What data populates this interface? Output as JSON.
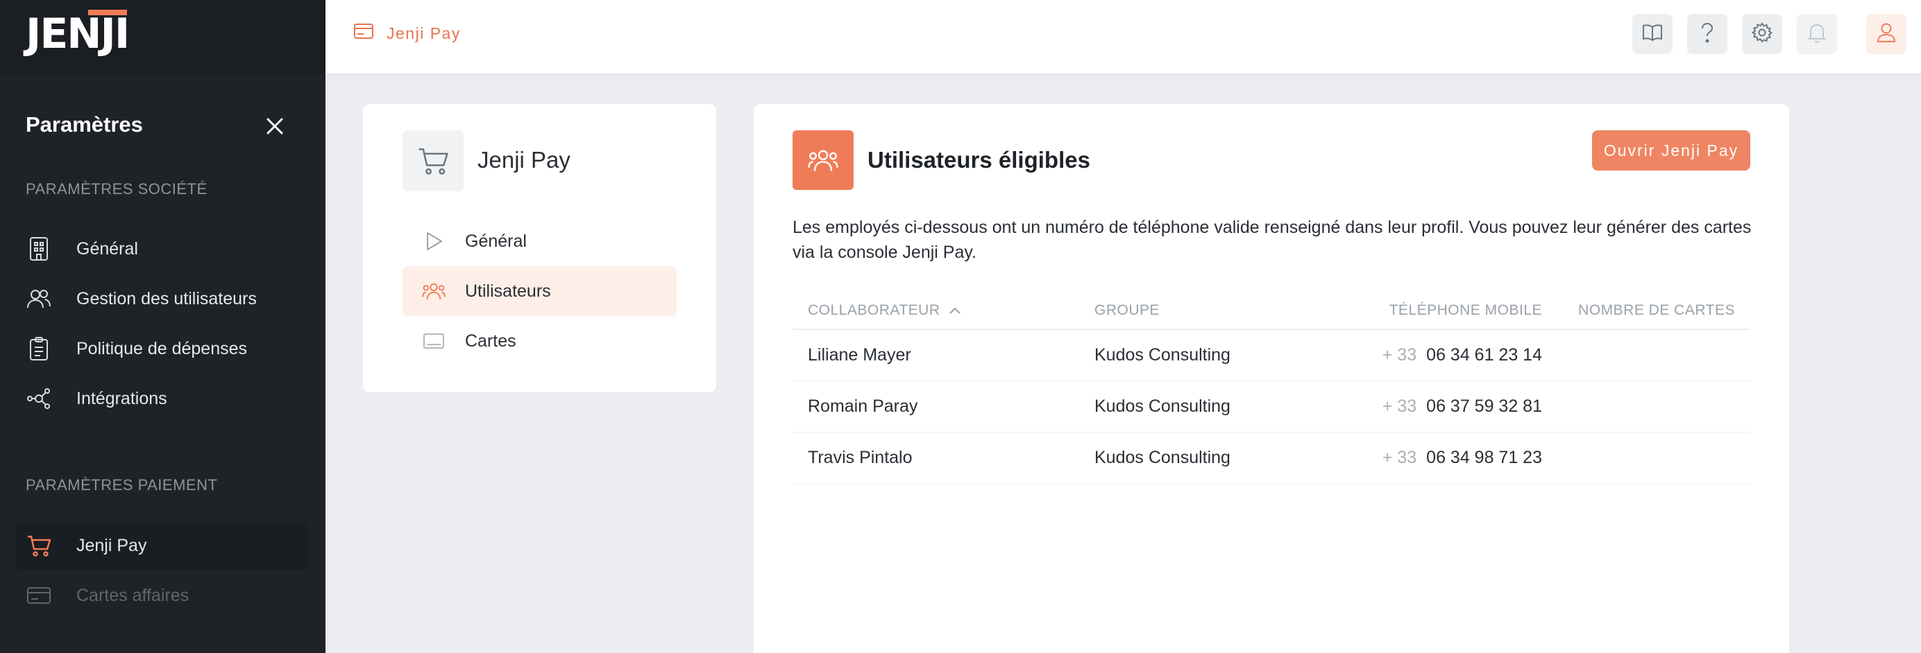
{
  "app": {
    "logo": "JENJI"
  },
  "sidebar": {
    "title": "Paramètres",
    "sections": [
      {
        "label": "PARAMÈTRES SOCIÉTÉ",
        "items": [
          {
            "label": "Général",
            "icon": "building-icon"
          },
          {
            "label": "Gestion des utilisateurs",
            "icon": "users-icon"
          },
          {
            "label": "Politique de dépenses",
            "icon": "clipboard-icon"
          },
          {
            "label": "Intégrations",
            "icon": "network-icon"
          }
        ]
      },
      {
        "label": "PARAMÈTRES PAIEMENT",
        "items": [
          {
            "label": "Jenji Pay",
            "icon": "cart-icon",
            "active": true
          },
          {
            "label": "Cartes affaires",
            "icon": "card-icon",
            "disabled": true
          }
        ]
      }
    ]
  },
  "topbar": {
    "breadcrumb": "Jenji Pay",
    "buttons": [
      "book-icon",
      "help-icon",
      "gear-icon",
      "bell-icon",
      "user-icon"
    ]
  },
  "left_card": {
    "title": "Jenji Pay",
    "items": [
      {
        "label": "Général",
        "icon": "play-icon"
      },
      {
        "label": "Utilisateurs",
        "icon": "users-icon",
        "active": true
      },
      {
        "label": "Cartes",
        "icon": "card-icon"
      }
    ]
  },
  "main": {
    "title": "Utilisateurs éligibles",
    "open_button": "Ouvrir Jenji Pay",
    "description": "Les employés ci-dessous ont un numéro de téléphone valide renseigné dans leur profil. Vous pouvez leur générer des cartes via la console Jenji Pay.",
    "columns": [
      "COLLABORATEUR",
      "GROUPE",
      "TÉLÉPHONE MOBILE",
      "NOMBRE DE CARTES"
    ],
    "rows": [
      {
        "name": "Liliane Mayer",
        "group": "Kudos Consulting",
        "prefix": "+ 33",
        "phone": "06 34 61 23 14",
        "cards": ""
      },
      {
        "name": "Romain Paray",
        "group": "Kudos Consulting",
        "prefix": "+ 33",
        "phone": "06 37 59 32 81",
        "cards": ""
      },
      {
        "name": "Travis Pintalo",
        "group": "Kudos Consulting",
        "prefix": "+ 33",
        "phone": "06 34 98 71 23",
        "cards": ""
      }
    ]
  },
  "colors": {
    "accent": "#ef7c58",
    "sidebar_bg": "#1f2328",
    "page_bg": "#ececf3"
  }
}
